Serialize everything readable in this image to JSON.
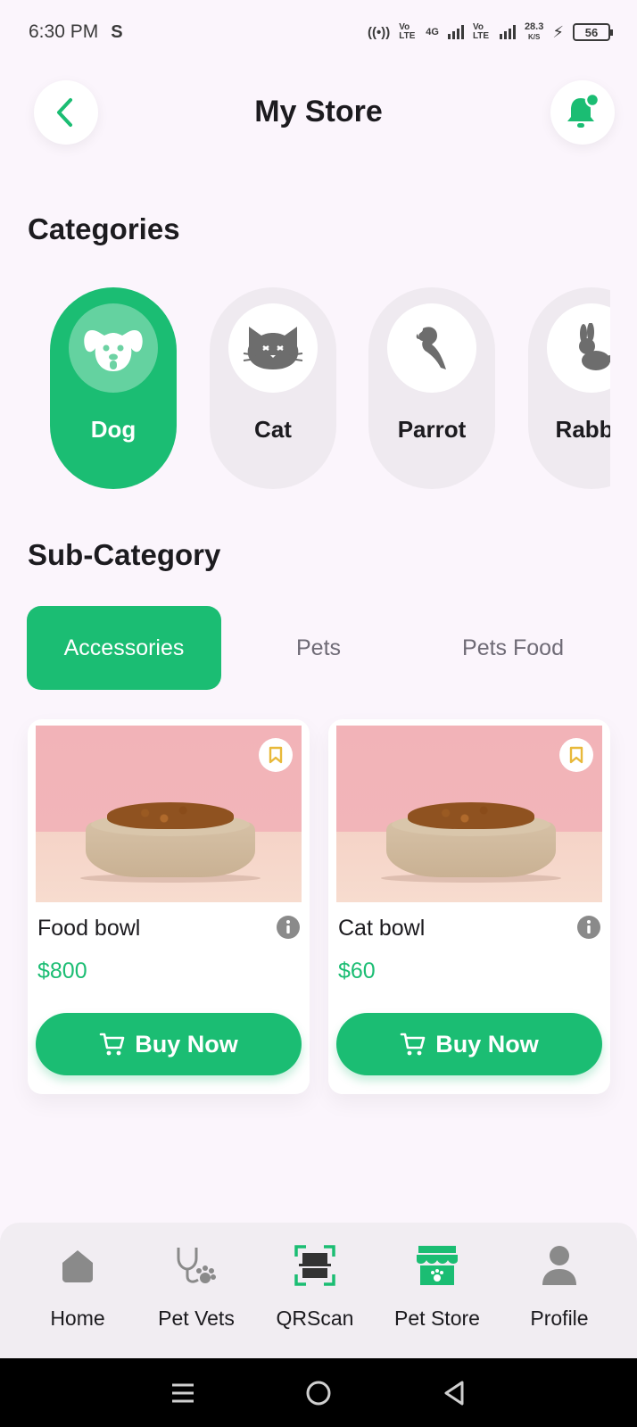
{
  "status_bar": {
    "time": "6:30 PM",
    "carrier_icon": "sim-s-icon",
    "network_1": "Vo LTE",
    "network_type": "4G",
    "network_2": "Vo LTE",
    "speed": "28.3",
    "speed_unit": "K/S",
    "battery": "56"
  },
  "header": {
    "title": "My Store",
    "back_icon": "back-arrow-icon",
    "bell_icon": "notification-bell-icon"
  },
  "categories": {
    "title": "Categories",
    "items": [
      {
        "label": "Dog",
        "icon": "dog-icon",
        "selected": true
      },
      {
        "label": "Cat",
        "icon": "cat-icon",
        "selected": false
      },
      {
        "label": "Parrot",
        "icon": "parrot-icon",
        "selected": false
      },
      {
        "label": "Rabbit",
        "icon": "rabbit-icon",
        "selected": false
      }
    ]
  },
  "sub_category": {
    "title": "Sub-Category",
    "tabs": [
      {
        "label": "Accessories",
        "selected": true
      },
      {
        "label": "Pets",
        "selected": false
      },
      {
        "label": "Pets Food",
        "selected": false
      }
    ]
  },
  "products": [
    {
      "name": "Food bowl",
      "price": "$800",
      "buy_label": "Buy Now"
    },
    {
      "name": "Cat bowl",
      "price": "$60",
      "buy_label": "Buy Now"
    }
  ],
  "bottom_nav": [
    {
      "label": "Home",
      "icon": "home-icon"
    },
    {
      "label": "Pet Vets",
      "icon": "stethoscope-icon"
    },
    {
      "label": "QRScan",
      "icon": "qr-scan-icon"
    },
    {
      "label": "Pet Store",
      "icon": "store-icon",
      "active": true
    },
    {
      "label": "Profile",
      "icon": "profile-icon"
    }
  ],
  "colors": {
    "accent": "#1bbd73",
    "background": "#fbf5fc",
    "pill_inactive": "#efeaf0",
    "bookmark": "#e8b93a"
  }
}
